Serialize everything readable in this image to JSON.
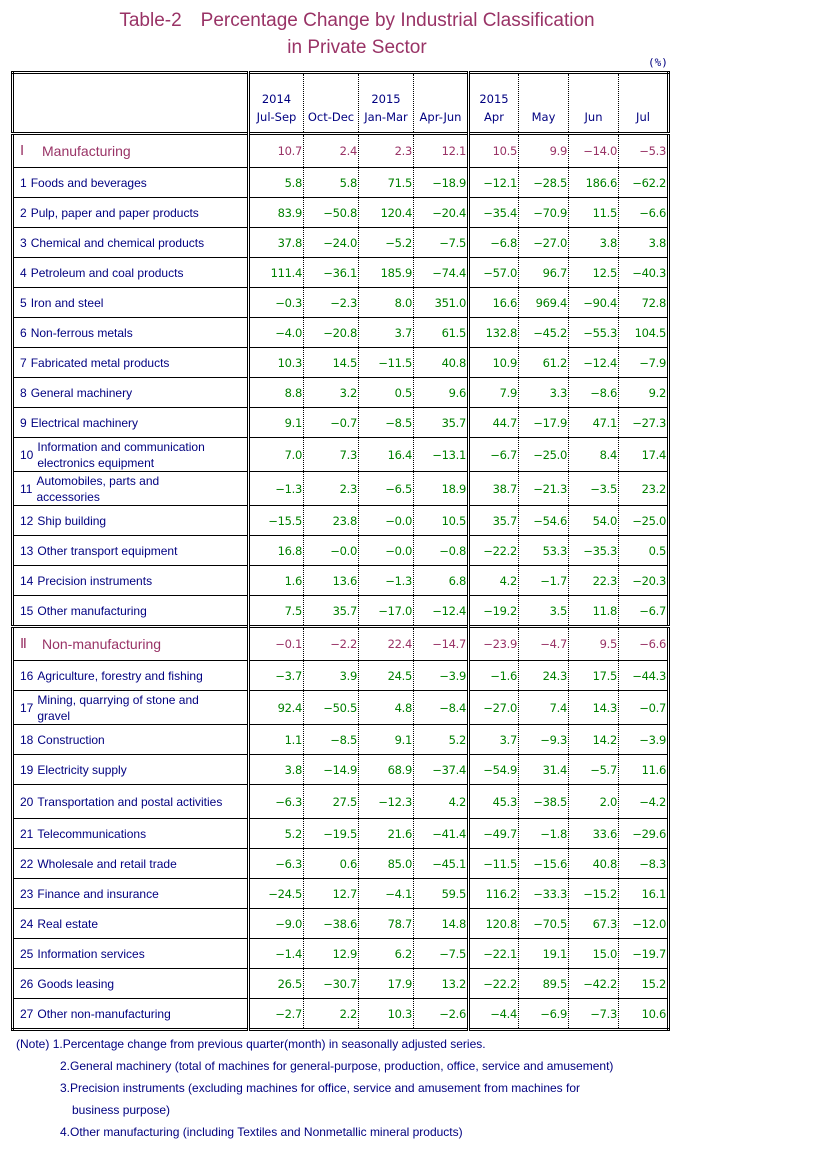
{
  "title": {
    "line1": "Table-2　Percentage Change by Industrial Classification",
    "line2": "in Private Sector"
  },
  "unit": "(%)",
  "header": {
    "columns": [
      {
        "year": "2014",
        "period": "Jul-Sep"
      },
      {
        "year": "",
        "period": "Oct-Dec"
      },
      {
        "year": "2015",
        "period": "Jan-Mar"
      },
      {
        "year": "",
        "period": "Apr-Jun"
      },
      {
        "year": "2015",
        "period": "Apr"
      },
      {
        "year": "",
        "period": "May"
      },
      {
        "year": "",
        "period": "Jun"
      },
      {
        "year": "",
        "period": "Jul"
      }
    ]
  },
  "rows": [
    {
      "type": "section",
      "num": "Ⅰ",
      "label": "Manufacturing",
      "values": [
        "10.7",
        "2.4",
        "2.3",
        "12.1",
        "10.5",
        "9.9",
        "−14.0",
        "−5.3"
      ]
    },
    {
      "type": "item",
      "num": "1",
      "label": "Foods and beverages",
      "values": [
        "5.8",
        "5.8",
        "71.5",
        "−18.9",
        "−12.1",
        "−28.5",
        "186.6",
        "−62.2"
      ]
    },
    {
      "type": "item",
      "num": "2",
      "label": "Pulp, paper and paper products",
      "values": [
        "83.9",
        "−50.8",
        "120.4",
        "−20.4",
        "−35.4",
        "−70.9",
        "11.5",
        "−6.6"
      ]
    },
    {
      "type": "item",
      "num": "3",
      "label": "Chemical and chemical products",
      "values": [
        "37.8",
        "−24.0",
        "−5.2",
        "−7.5",
        "−6.8",
        "−27.0",
        "3.8",
        "3.8"
      ]
    },
    {
      "type": "item",
      "num": "4",
      "label": "Petroleum and coal products",
      "values": [
        "111.4",
        "−36.1",
        "185.9",
        "−74.4",
        "−57.0",
        "96.7",
        "12.5",
        "−40.3"
      ]
    },
    {
      "type": "item",
      "num": "5",
      "label": "Iron and steel",
      "values": [
        "−0.3",
        "−2.3",
        "8.0",
        "351.0",
        "16.6",
        "969.4",
        "−90.4",
        "72.8"
      ]
    },
    {
      "type": "item",
      "num": "6",
      "label": "Non-ferrous metals",
      "values": [
        "−4.0",
        "−20.8",
        "3.7",
        "61.5",
        "132.8",
        "−45.2",
        "−55.3",
        "104.5"
      ]
    },
    {
      "type": "item",
      "num": "7",
      "label": "Fabricated metal products",
      "values": [
        "10.3",
        "14.5",
        "−11.5",
        "40.8",
        "10.9",
        "61.2",
        "−12.4",
        "−7.9"
      ]
    },
    {
      "type": "item",
      "num": "8",
      "label": "General machinery",
      "values": [
        "8.8",
        "3.2",
        "0.5",
        "9.6",
        "7.9",
        "3.3",
        "−8.6",
        "9.2"
      ]
    },
    {
      "type": "item",
      "num": "9",
      "label": "Electrical machinery",
      "values": [
        "9.1",
        "−0.7",
        "−8.5",
        "35.7",
        "44.7",
        "−17.9",
        "47.1",
        "−27.3"
      ]
    },
    {
      "type": "item2",
      "num": "10",
      "label": "Information and communication electronics equipment",
      "values": [
        "7.0",
        "7.3",
        "16.4",
        "−13.1",
        "−6.7",
        "−25.0",
        "8.4",
        "17.4"
      ]
    },
    {
      "type": "item2",
      "num": "11",
      "label": "Automobiles, parts and accessories",
      "values": [
        "−1.3",
        "2.3",
        "−6.5",
        "18.9",
        "38.7",
        "−21.3",
        "−3.5",
        "23.2"
      ]
    },
    {
      "type": "item",
      "num": "12",
      "label": "Ship building",
      "values": [
        "−15.5",
        "23.8",
        "−0.0",
        "10.5",
        "35.7",
        "−54.6",
        "54.0",
        "−25.0"
      ]
    },
    {
      "type": "item",
      "num": "13",
      "label": "Other transport equipment",
      "values": [
        "16.8",
        "−0.0",
        "−0.0",
        "−0.8",
        "−22.2",
        "53.3",
        "−35.3",
        "0.5"
      ]
    },
    {
      "type": "item",
      "num": "14",
      "label": "Precision instruments",
      "values": [
        "1.6",
        "13.6",
        "−1.3",
        "6.8",
        "4.2",
        "−1.7",
        "22.3",
        "−20.3"
      ]
    },
    {
      "type": "item",
      "num": "15",
      "label": "Other manufacturing",
      "values": [
        "7.5",
        "35.7",
        "−17.0",
        "−12.4",
        "−19.2",
        "3.5",
        "11.8",
        "−6.7"
      ]
    },
    {
      "type": "section",
      "num": "Ⅱ",
      "label": "Non-manufacturing",
      "values": [
        "−0.1",
        "−2.2",
        "22.4",
        "−14.7",
        "−23.9",
        "−4.7",
        "9.5",
        "−6.6"
      ]
    },
    {
      "type": "item",
      "num": "16",
      "label": "Agriculture, forestry and fishing",
      "values": [
        "−3.7",
        "3.9",
        "24.5",
        "−3.9",
        "−1.6",
        "24.3",
        "17.5",
        "−44.3"
      ]
    },
    {
      "type": "item2",
      "num": "17",
      "label": "Mining, quarrying of stone and gravel",
      "values": [
        "92.4",
        "−50.5",
        "4.8",
        "−8.4",
        "−27.0",
        "7.4",
        "14.3",
        "−0.7"
      ]
    },
    {
      "type": "item",
      "num": "18",
      "label": "Construction",
      "values": [
        "1.1",
        "−8.5",
        "9.1",
        "5.2",
        "3.7",
        "−9.3",
        "14.2",
        "−3.9"
      ]
    },
    {
      "type": "item",
      "num": "19",
      "label": "Electricity supply",
      "values": [
        "3.8",
        "−14.9",
        "68.9",
        "−37.4",
        "−54.9",
        "31.4",
        "−5.7",
        "11.6"
      ]
    },
    {
      "type": "tall",
      "num": "20",
      "label": "Transportation and postal activities",
      "values": [
        "−6.3",
        "27.5",
        "−12.3",
        "4.2",
        "45.3",
        "−38.5",
        "2.0",
        "−4.2"
      ]
    },
    {
      "type": "item",
      "num": "21",
      "label": "Telecommunications",
      "values": [
        "5.2",
        "−19.5",
        "21.6",
        "−41.4",
        "−49.7",
        "−1.8",
        "33.6",
        "−29.6"
      ]
    },
    {
      "type": "item",
      "num": "22",
      "label": "Wholesale and retail trade",
      "values": [
        "−6.3",
        "0.6",
        "85.0",
        "−45.1",
        "−11.5",
        "−15.6",
        "40.8",
        "−8.3"
      ]
    },
    {
      "type": "item",
      "num": "23",
      "label": "Finance and insurance",
      "values": [
        "−24.5",
        "12.7",
        "−4.1",
        "59.5",
        "116.2",
        "−33.3",
        "−15.2",
        "16.1"
      ]
    },
    {
      "type": "item",
      "num": "24",
      "label": "Real estate",
      "values": [
        "−9.0",
        "−38.6",
        "78.7",
        "14.8",
        "120.8",
        "−70.5",
        "67.3",
        "−12.0"
      ]
    },
    {
      "type": "item",
      "num": "25",
      "label": "Information services",
      "values": [
        "−1.4",
        "12.9",
        "6.2",
        "−7.5",
        "−22.1",
        "19.1",
        "15.0",
        "−19.7"
      ]
    },
    {
      "type": "item",
      "num": "26",
      "label": "Goods leasing",
      "values": [
        "26.5",
        "−30.7",
        "17.9",
        "13.2",
        "−22.2",
        "89.5",
        "−42.2",
        "15.2"
      ]
    },
    {
      "type": "item",
      "num": "27",
      "label": "Other non-manufacturing",
      "values": [
        "−2.7",
        "2.2",
        "10.3",
        "−2.6",
        "−4.4",
        "−6.9",
        "−7.3",
        "10.6"
      ]
    }
  ],
  "notes": {
    "prefix": "(Note) ",
    "items": [
      "1.Percentage change from previous quarter(month) in seasonally adjusted series.",
      "2.General machinery (total of machines for general-purpose, production, office, service and amusement)",
      "3.Precision instruments (excluding machines for office, service and amusement from machines for",
      "business purpose)",
      "4.Other manufacturing (including Textiles and Nonmetallic mineral products)"
    ]
  },
  "colors": {
    "title": "#993366",
    "section": "#993366",
    "label": "#000080",
    "value": "#008000"
  }
}
